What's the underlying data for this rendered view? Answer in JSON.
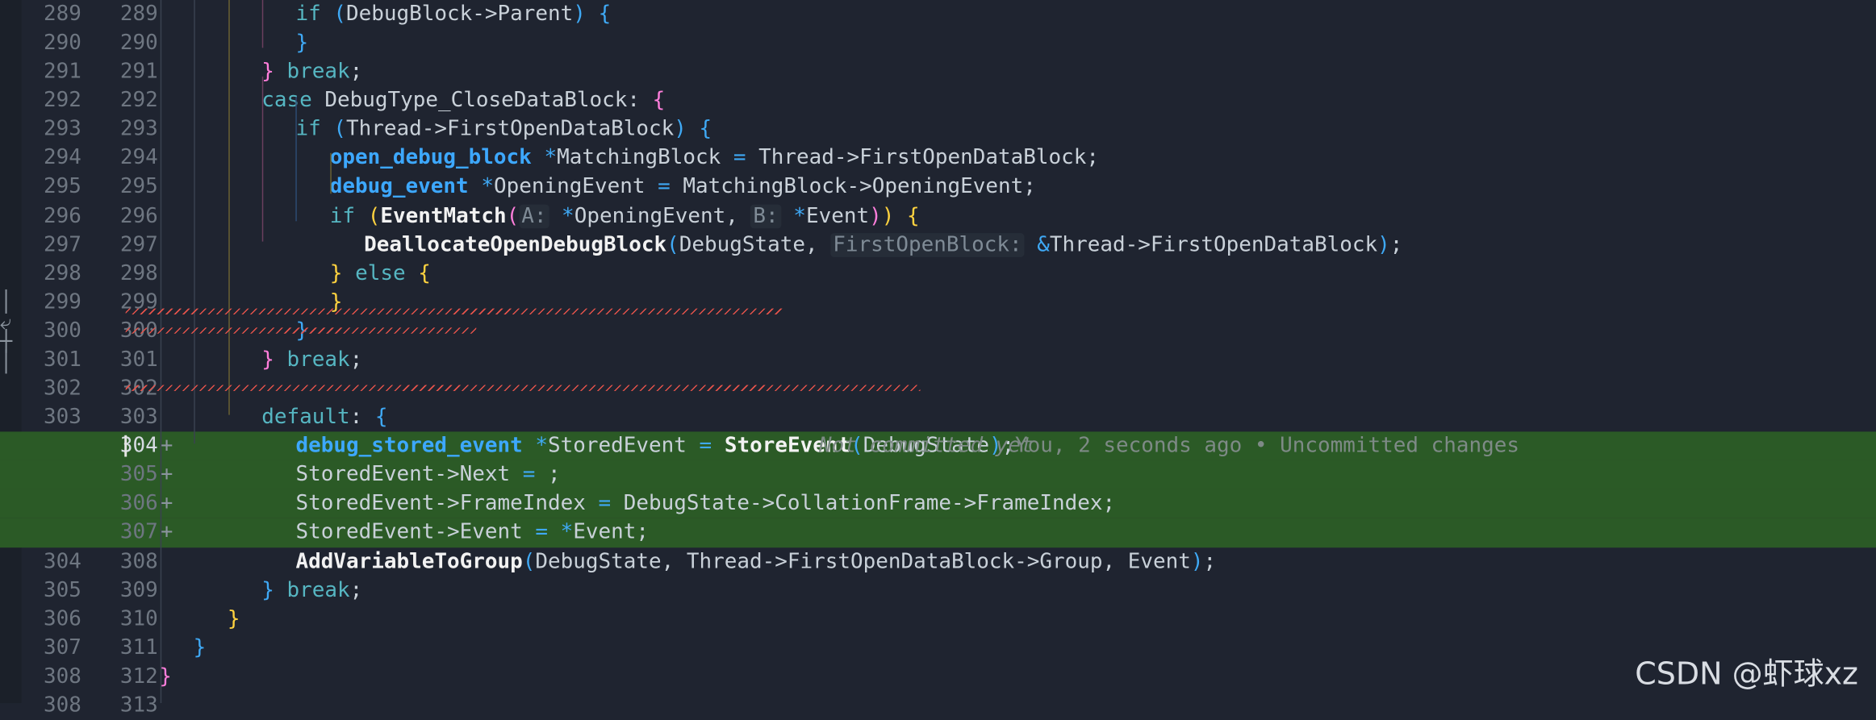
{
  "editor": {
    "lines": [
      {
        "old": "289",
        "new": "289",
        "added": false,
        "indent": 5,
        "tokens": [
          [
            "kw",
            "if"
          ],
          [
            "id",
            " "
          ],
          [
            "p2",
            "("
          ],
          [
            "id",
            "DebugBlock"
          ],
          [
            "id",
            "->"
          ],
          [
            "id",
            "Parent"
          ],
          [
            "p2",
            ")"
          ],
          [
            "id",
            " "
          ],
          [
            "p2",
            "{"
          ]
        ]
      },
      {
        "old": "290",
        "new": "290",
        "added": false,
        "indent": 5,
        "tokens": [
          [
            "p2",
            "}"
          ]
        ]
      },
      {
        "old": "291",
        "new": "291",
        "added": false,
        "indent": 4,
        "tokens": [
          [
            "p1",
            "}"
          ],
          [
            "id",
            " "
          ],
          [
            "kw",
            "break"
          ],
          [
            "id",
            ";"
          ]
        ]
      },
      {
        "old": "292",
        "new": "292",
        "added": false,
        "indent": 4,
        "tokens": [
          [
            "kw",
            "case"
          ],
          [
            "id",
            " DebugType_CloseDataBlock: "
          ],
          [
            "p1",
            "{"
          ]
        ]
      },
      {
        "old": "293",
        "new": "293",
        "added": false,
        "indent": 5,
        "tokens": [
          [
            "kw",
            "if"
          ],
          [
            "id",
            " "
          ],
          [
            "p2",
            "("
          ],
          [
            "id",
            "Thread->FirstOpenDataBlock"
          ],
          [
            "p2",
            ")"
          ],
          [
            "id",
            " "
          ],
          [
            "p2",
            "{"
          ]
        ]
      },
      {
        "old": "294",
        "new": "294",
        "added": false,
        "indent": 6,
        "tokens": [
          [
            "ty",
            "open_debug_block"
          ],
          [
            "id",
            " "
          ],
          [
            "op",
            "*"
          ],
          [
            "id",
            "MatchingBlock "
          ],
          [
            "op",
            "="
          ],
          [
            "id",
            " Thread->FirstOpenDataBlock;"
          ]
        ]
      },
      {
        "old": "295",
        "new": "295",
        "added": false,
        "indent": 6,
        "tokens": [
          [
            "ty",
            "debug_event"
          ],
          [
            "id",
            " "
          ],
          [
            "op",
            "*"
          ],
          [
            "id",
            "OpeningEvent "
          ],
          [
            "op",
            "="
          ],
          [
            "id",
            " MatchingBlock->OpeningEvent;"
          ]
        ]
      },
      {
        "old": "296",
        "new": "296",
        "added": false,
        "indent": 6,
        "tokens": [
          [
            "kw",
            "if"
          ],
          [
            "id",
            " "
          ],
          [
            "p3",
            "("
          ],
          [
            "fn",
            "EventMatch"
          ],
          [
            "p1",
            "("
          ],
          [
            "hint",
            "A:"
          ],
          [
            "id",
            " "
          ],
          [
            "op",
            "*"
          ],
          [
            "id",
            "OpeningEvent, "
          ],
          [
            "hint",
            "B:"
          ],
          [
            "id",
            " "
          ],
          [
            "op",
            "*"
          ],
          [
            "id",
            "Event"
          ],
          [
            "p1",
            ")"
          ],
          [
            "p3",
            ")"
          ],
          [
            "id",
            " "
          ],
          [
            "p3",
            "{"
          ]
        ]
      },
      {
        "old": "297",
        "new": "297",
        "added": false,
        "indent": 7,
        "tokens": [
          [
            "fn",
            "DeallocateOpenDebugBlock"
          ],
          [
            "p2",
            "("
          ],
          [
            "id",
            "DebugState, "
          ],
          [
            "hint",
            "FirstOpenBlock:"
          ],
          [
            "id",
            " "
          ],
          [
            "op",
            "&"
          ],
          [
            "id",
            "Thread->FirstOpenDataBlock"
          ],
          [
            "p2",
            ")"
          ],
          [
            "id",
            ";"
          ]
        ]
      },
      {
        "old": "298",
        "new": "298",
        "added": false,
        "indent": 6,
        "tokens": [
          [
            "p3",
            "}"
          ],
          [
            "id",
            " "
          ],
          [
            "kw",
            "else"
          ],
          [
            "id",
            " "
          ],
          [
            "p3",
            "{"
          ]
        ]
      },
      {
        "old": "299",
        "new": "299",
        "added": false,
        "indent": 6,
        "tokens": [
          [
            "p3",
            "}"
          ]
        ]
      },
      {
        "old": "300",
        "new": "300",
        "added": false,
        "indent": 5,
        "tokens": [
          [
            "p2",
            "}"
          ]
        ]
      },
      {
        "old": "301",
        "new": "301",
        "added": false,
        "indent": 4,
        "tokens": [
          [
            "p1",
            "}"
          ],
          [
            "id",
            " "
          ],
          [
            "kw",
            "break"
          ],
          [
            "id",
            ";"
          ]
        ]
      },
      {
        "old": "302",
        "new": "302",
        "added": false,
        "indent": 0,
        "tokens": []
      },
      {
        "old": "303",
        "new": "303",
        "added": false,
        "indent": 4,
        "tokens": [
          [
            "kw",
            "default"
          ],
          [
            "id",
            ": "
          ],
          [
            "p2",
            "{"
          ]
        ]
      },
      {
        "old": "",
        "new": "304",
        "added": true,
        "indent": 5,
        "tokens": [
          [
            "ty",
            "debug_stored_event"
          ],
          [
            "id",
            " "
          ],
          [
            "op",
            "*"
          ],
          [
            "id",
            "StoredEvent "
          ],
          [
            "op",
            "="
          ],
          [
            "id",
            " "
          ],
          [
            "fn",
            "StoreEvent"
          ],
          [
            "p2",
            "("
          ],
          [
            "id",
            "DebugState"
          ],
          [
            "p2",
            ")"
          ],
          [
            "id",
            ";"
          ]
        ],
        "blame": "Not committed yet",
        "blame_right": "You, 2 seconds ago • Uncommitted changes"
      },
      {
        "old": "",
        "new": "305",
        "added": true,
        "indent": 5,
        "tokens": [
          [
            "id",
            "StoredEvent->Next "
          ],
          [
            "op",
            "="
          ],
          [
            "id",
            " ;"
          ]
        ]
      },
      {
        "old": "",
        "new": "306",
        "added": true,
        "indent": 5,
        "tokens": [
          [
            "id",
            "StoredEvent->FrameIndex "
          ],
          [
            "op",
            "="
          ],
          [
            "id",
            " DebugState->CollationFrame->FrameIndex;"
          ]
        ]
      },
      {
        "old": "",
        "new": "307",
        "added": true,
        "indent": 5,
        "tokens": [
          [
            "id",
            "StoredEvent->Event "
          ],
          [
            "op",
            "="
          ],
          [
            "id",
            " "
          ],
          [
            "op",
            "*"
          ],
          [
            "id",
            "Event;"
          ]
        ]
      },
      {
        "old": "304",
        "new": "308",
        "added": false,
        "indent": 5,
        "tokens": [
          [
            "fn",
            "AddVariableToGroup"
          ],
          [
            "p2",
            "("
          ],
          [
            "id",
            "DebugState, Thread->FirstOpenDataBlock->Group, Event"
          ],
          [
            "p2",
            ")"
          ],
          [
            "id",
            ";"
          ]
        ]
      },
      {
        "old": "305",
        "new": "309",
        "added": false,
        "indent": 4,
        "tokens": [
          [
            "p2",
            "}"
          ],
          [
            "id",
            " "
          ],
          [
            "kw",
            "break"
          ],
          [
            "id",
            ";"
          ]
        ]
      },
      {
        "old": "306",
        "new": "310",
        "added": false,
        "indent": 3,
        "tokens": [
          [
            "p3",
            "}"
          ]
        ]
      },
      {
        "old": "307",
        "new": "311",
        "added": false,
        "indent": 2,
        "tokens": [
          [
            "p2",
            "}"
          ]
        ]
      },
      {
        "old": "308",
        "new": "312",
        "added": false,
        "indent": 1,
        "tokens": [
          [
            "p1",
            "}"
          ]
        ]
      },
      {
        "old": "308",
        "new": "313",
        "added": false,
        "indent": 0,
        "tokens": []
      }
    ],
    "cursor_line_new": "304"
  },
  "watermark": "CSDN @虾球xz",
  "colors": {
    "background": "#1f2430",
    "added_line": "#2b5a26",
    "keyword": "#56b6c2",
    "type": "#3da8ff",
    "error_squiggle": "#e5534b"
  }
}
